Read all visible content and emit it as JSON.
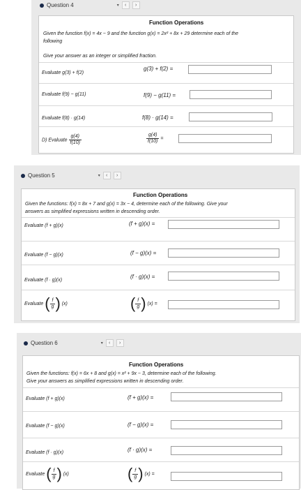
{
  "q4": {
    "header": "Question 4",
    "title": "Function Operations",
    "intro": "Given the function f(x) = 4x − 9 and the function g(x) = 2x² + 8x + 29 determine each of the",
    "intro2": "following",
    "instructions": "Give your answer as an integer or simplified fraction.",
    "rows": [
      {
        "label": "Evaluate g(3) + f(2)",
        "eq": "g(3) + f(2) ="
      },
      {
        "label": "Evaluate f(9) − g(11)",
        "eq": "f(9) − g(11) ="
      },
      {
        "label": "Evaluate f(8) · g(14)",
        "eq": "f(8) · g(14) ="
      },
      {
        "label": "D) Evaluate",
        "num": "g(4)",
        "den": "f(10)",
        "eq": "="
      }
    ]
  },
  "q5": {
    "header": "Question 5",
    "title": "Function Operations",
    "intro": "Given the functions: f(x) = 8x + 7 and g(x) = 3x − 4, determine each of the following. Give your",
    "intro2": "answers as simplified expressions written in descending order.",
    "rows": [
      {
        "label": "Evaluate (f + g)(x)",
        "eq": "(f + g)(x) ="
      },
      {
        "label": "Evaluate (f − g)(x)",
        "eq": "(f − g)(x) ="
      },
      {
        "label": "Evaluate (f · g)(x)",
        "eq": "(f · g)(x) ="
      },
      {
        "label": "Evaluate",
        "num": "f",
        "den": "g",
        "tail": "(x)",
        "eq": "(x) ="
      }
    ]
  },
  "q6": {
    "header": "Question 6",
    "title": "Function Operations",
    "intro": "Given the functions: f(x) = 6x + 8 and g(x) = x² + 9x − 3, determine each of the following.",
    "intro2": "Give your answers as simplified expressions written in descending order.",
    "rows": [
      {
        "label": "Evaluate (f + g)(x)",
        "eq": "(f + g)(x) ="
      },
      {
        "label": "Evaluate (f − g)(x)",
        "eq": "(f − g)(x) ="
      },
      {
        "label": "Evaluate (f · g)(x)",
        "eq": "(f · g)(x) ="
      },
      {
        "label": "Evaluate",
        "num": "f",
        "den": "g",
        "tail": "(x)",
        "eq": "(x) ="
      }
    ]
  },
  "nav": {
    "prev": "‹",
    "next": "›",
    "caret": "▾"
  }
}
